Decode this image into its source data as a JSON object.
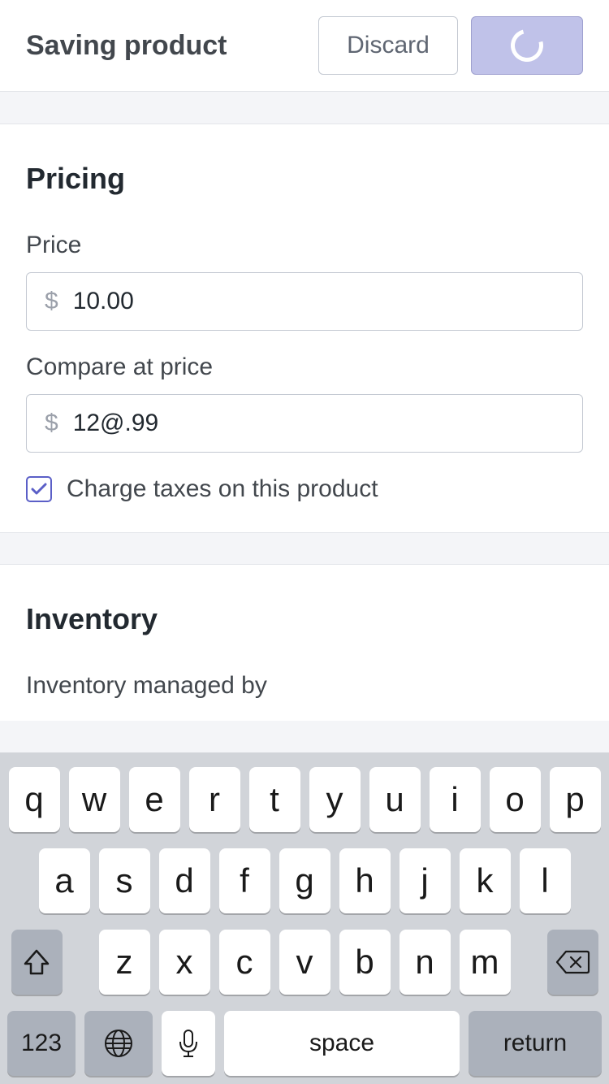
{
  "header": {
    "title": "Saving product",
    "discard_label": "Discard"
  },
  "pricing": {
    "section_title": "Pricing",
    "price_label": "Price",
    "price_prefix": "$",
    "price_value": "10.00",
    "compare_label": "Compare at price",
    "compare_prefix": "$",
    "compare_value": "12@.99",
    "tax_checkbox_checked": true,
    "tax_label": "Charge taxes on this product"
  },
  "inventory": {
    "section_title": "Inventory",
    "managed_by_label": "Inventory managed by"
  },
  "keyboard": {
    "row1": [
      "q",
      "w",
      "e",
      "r",
      "t",
      "y",
      "u",
      "i",
      "o",
      "p"
    ],
    "row2": [
      "a",
      "s",
      "d",
      "f",
      "g",
      "h",
      "j",
      "k",
      "l"
    ],
    "row3": [
      "z",
      "x",
      "c",
      "v",
      "b",
      "n",
      "m"
    ],
    "numkey_label": "123",
    "space_label": "space",
    "return_label": "return"
  }
}
